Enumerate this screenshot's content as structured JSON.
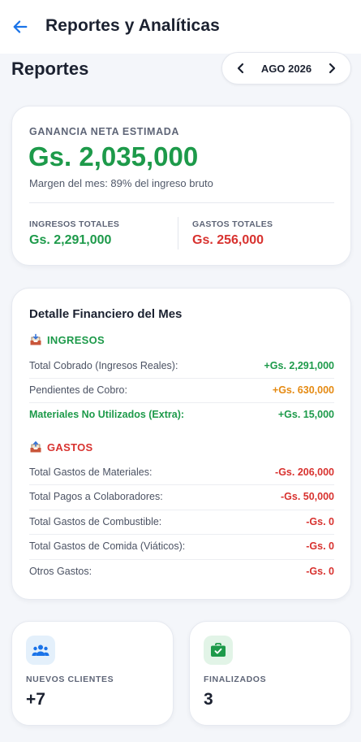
{
  "appbar": {
    "title": "Reportes y Analíticas"
  },
  "reports": {
    "title": "Reportes",
    "month": "AGO 2026"
  },
  "summary": {
    "kicker": "GANANCIA NETA ESTIMADA",
    "amount": "Gs. 2,035,000",
    "margin": "Margen del mes: 89% del ingreso bruto",
    "income_label": "INGRESOS TOTALES",
    "income_value": "Gs. 2,291,000",
    "expense_label": "GASTOS TOTALES",
    "expense_value": "Gs. 256,000"
  },
  "detail": {
    "title": "Detalle Financiero del Mes",
    "income_head": "INGRESOS",
    "income_rows": [
      {
        "label": "Total Cobrado (Ingresos Reales):",
        "value": "+Gs. 2,291,000"
      },
      {
        "label": "Pendientes de Cobro:",
        "value": "+Gs. 630,000"
      },
      {
        "label": "Materiales No Utilizados (Extra):",
        "value": "+Gs. 15,000"
      }
    ],
    "expense_head": "GASTOS",
    "expense_rows": [
      {
        "label": "Total Gastos de Materiales:",
        "value": "-Gs. 206,000"
      },
      {
        "label": "Total Pagos a Colaboradores:",
        "value": "-Gs. 50,000"
      },
      {
        "label": "Total Gastos de Combustible:",
        "value": "-Gs. 0"
      },
      {
        "label": "Total Gastos de Comida (Viáticos):",
        "value": "-Gs. 0"
      },
      {
        "label": "Otros Gastos:",
        "value": "-Gs. 0"
      }
    ]
  },
  "stats": {
    "clients": {
      "label": "NUEVOS CLIENTES",
      "value": "+7",
      "icon": "group-icon"
    },
    "finished": {
      "label": "FINALIZADOS",
      "value": "3",
      "icon": "briefcase-check-icon"
    }
  },
  "colors": {
    "green": "#1d9a4a",
    "red": "#d8322f",
    "orange": "#e58a12",
    "blue": "#1a73e8"
  }
}
